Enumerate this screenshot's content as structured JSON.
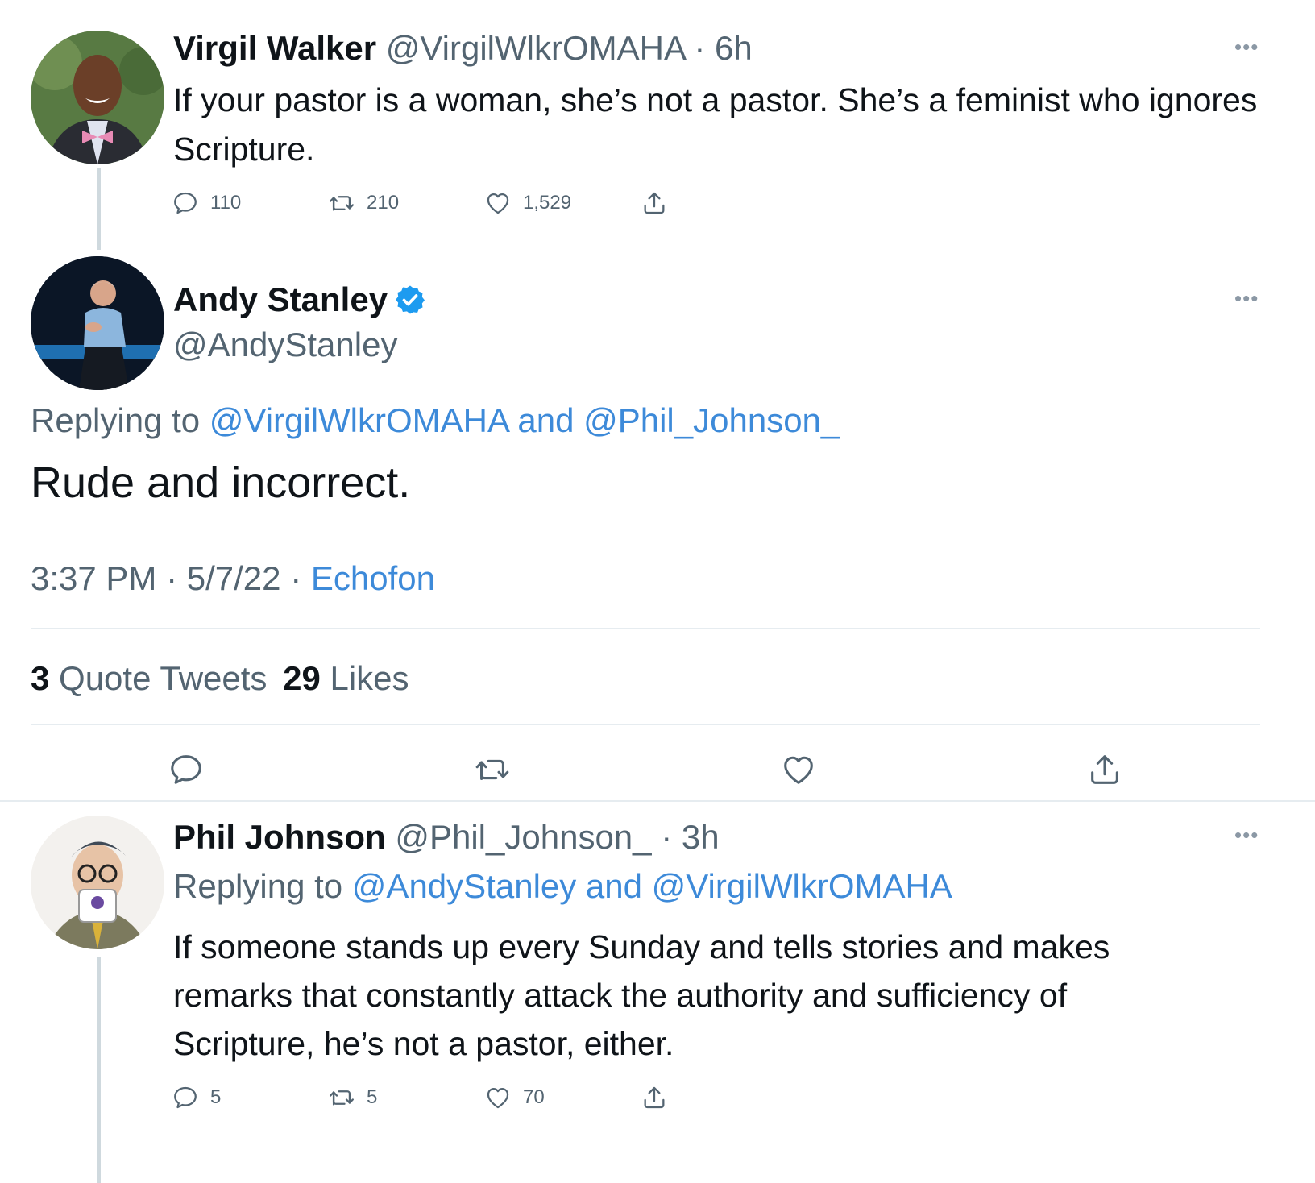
{
  "tweet1": {
    "name": "Virgil Walker",
    "handle": "@VirgilWlkrOMAHA",
    "time": "6h",
    "text": "If your pastor is a woman, she’s not a pastor. She’s a feminist who ignores Scripture.",
    "replies": "110",
    "retweets": "210",
    "likes": "1,529"
  },
  "tweet2": {
    "name": "Andy Stanley",
    "handle": "@AndyStanley",
    "verified": true,
    "replying_label": "Replying to",
    "replying_to": "@VirgilWlkrOMAHA and @Phil_Johnson_",
    "text": "Rude and incorrect.",
    "time": "3:37 PM",
    "date": "5/7/22",
    "source": "Echofon",
    "quote_count": "3",
    "quote_label": "Quote Tweets",
    "like_count": "29",
    "like_label": "Likes"
  },
  "tweet3": {
    "name": "Phil Johnson",
    "handle": "@Phil_Johnson_",
    "time": "3h",
    "replying_label": "Replying to",
    "replying_to": "@AndyStanley and @VirgilWlkrOMAHA",
    "text_lines": [
      "If someone stands up every Sunday and tells stories and makes",
      "remarks that constantly attack the authority and sufficiency of",
      "Scripture, he’s not a pastor, either."
    ],
    "replies": "5",
    "retweets": "5",
    "likes": "70"
  },
  "colors": {
    "link": "#3d8ad9",
    "muted": "#536471",
    "verified": "#1d9bf0",
    "divider": "#e6ecf0"
  },
  "icons": [
    "reply-icon",
    "retweet-icon",
    "like-icon",
    "share-icon",
    "more-icon",
    "verified-badge-icon"
  ]
}
